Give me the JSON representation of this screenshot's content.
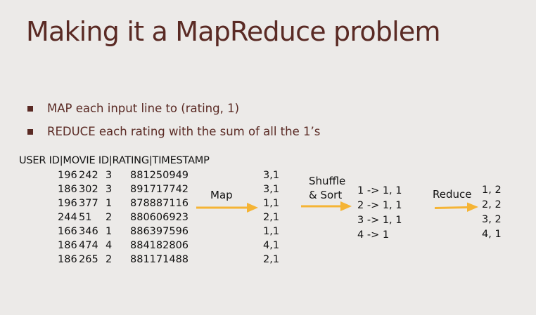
{
  "slide": {
    "title": "Making it a MapReduce problem",
    "bullets": [
      "MAP each input line to (rating, 1)",
      "REDUCE each rating with the sum of all the 1’s"
    ]
  },
  "input_table": {
    "header": "USER ID|MOVIE ID|RATING|TIMESTAMP",
    "rows": [
      {
        "user": "196",
        "movie": "242",
        "rating": "3",
        "timestamp": "881250949"
      },
      {
        "user": "186",
        "movie": "302",
        "rating": "3",
        "timestamp": "891717742"
      },
      {
        "user": "196",
        "movie": "377",
        "rating": "1",
        "timestamp": "878887116"
      },
      {
        "user": "244",
        "movie": "51",
        "rating": "2",
        "timestamp": "880606923"
      },
      {
        "user": "166",
        "movie": "346",
        "rating": "1",
        "timestamp": "886397596"
      },
      {
        "user": "186",
        "movie": "474",
        "rating": "4",
        "timestamp": "884182806"
      },
      {
        "user": "186",
        "movie": "265",
        "rating": "2",
        "timestamp": "881171488"
      }
    ]
  },
  "map": {
    "label": "Map",
    "output": [
      "3,1",
      "3,1",
      "1,1",
      "2,1",
      "1,1",
      "4,1",
      "2,1"
    ]
  },
  "shuffle": {
    "label_line1": "Shuffle",
    "label_line2": "& Sort",
    "output": [
      "1 -> 1, 1",
      "2 -> 1, 1",
      "3 -> 1, 1",
      "4 -> 1"
    ]
  },
  "reduce": {
    "label": "Reduce",
    "output": [
      "1, 2",
      "2, 2",
      "3, 2",
      "4, 1"
    ]
  },
  "colors": {
    "background": "#eceae8",
    "title": "#5a2a24",
    "text": "#111111",
    "arrow": "#f5b435"
  }
}
